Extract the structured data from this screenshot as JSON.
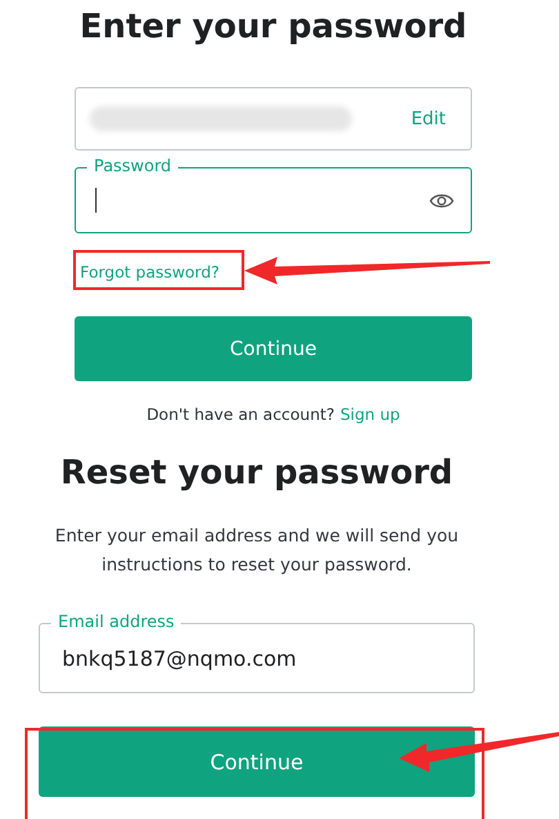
{
  "login": {
    "title": "Enter your password",
    "edit_link": "Edit",
    "password_label": "Password",
    "forgot_link": "Forgot password?",
    "continue_button": "Continue",
    "signup_prompt": "Don't have an account?",
    "signup_link": "Sign up"
  },
  "reset": {
    "title": "Reset your password",
    "instructions": "Enter your email address and we will send you instructions to reset your password.",
    "email_label": "Email address",
    "email_value": "bnkq5187@nqmo.com",
    "continue_button": "Continue"
  }
}
